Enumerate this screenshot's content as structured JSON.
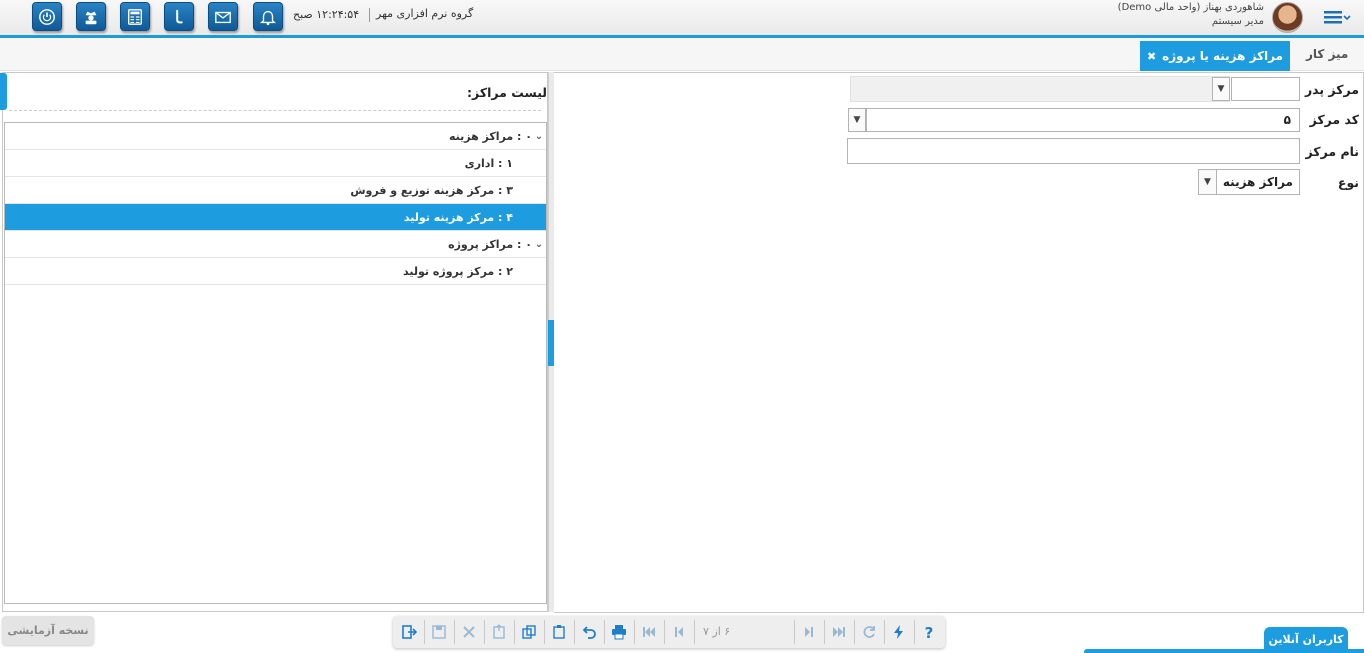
{
  "topbar": {
    "company": "گروه نرم افزاری مهر",
    "clock": "۱۲:۲۴:۵۴ صبح",
    "user_name": "شاهوردی بهناز (واحد مالی Demo)",
    "user_role": "مدیر سیستم",
    "icons": [
      "power-icon",
      "chief-icon",
      "calculator-icon",
      "phone-icon",
      "mail-icon",
      "bell-icon"
    ]
  },
  "tabs": {
    "desk": "میز کار",
    "active": "مراکز هزینه یا پروژه",
    "close_symbol": "✖"
  },
  "list": {
    "title": "لیست مراکز:",
    "rows": [
      {
        "label": "۰ : مراکز هزینه",
        "level": 1,
        "expandable": true,
        "selected": false
      },
      {
        "label": "۱ : اداری",
        "level": 2,
        "expandable": false,
        "selected": false
      },
      {
        "label": "۳ : مرکز هزینه توزیع و فروش",
        "level": 2,
        "expandable": false,
        "selected": false
      },
      {
        "label": "۴ : مرکز هزینه تولید",
        "level": 2,
        "expandable": false,
        "selected": true
      },
      {
        "label": "۰ : مراکز پروژه",
        "level": 1,
        "expandable": true,
        "selected": false
      },
      {
        "label": "۲ : مرکز پروژه تولید",
        "level": 2,
        "expandable": false,
        "selected": false
      }
    ]
  },
  "form": {
    "parent_label": "مرکز پدر",
    "parent_value": "",
    "code_label": "کد مرکز",
    "code_value": "۵",
    "name_label": "نام مرکز",
    "name_value": "",
    "type_label": "نوع",
    "type_value": "مراکز هزینه"
  },
  "bottom": {
    "trial": "نسخه آزمایشی",
    "record_position": "۶ از ۷",
    "online_users": "کاربران آنلاین"
  },
  "colors": {
    "accent": "#1d9ce0",
    "topbar_button": "#1a6fb0"
  }
}
